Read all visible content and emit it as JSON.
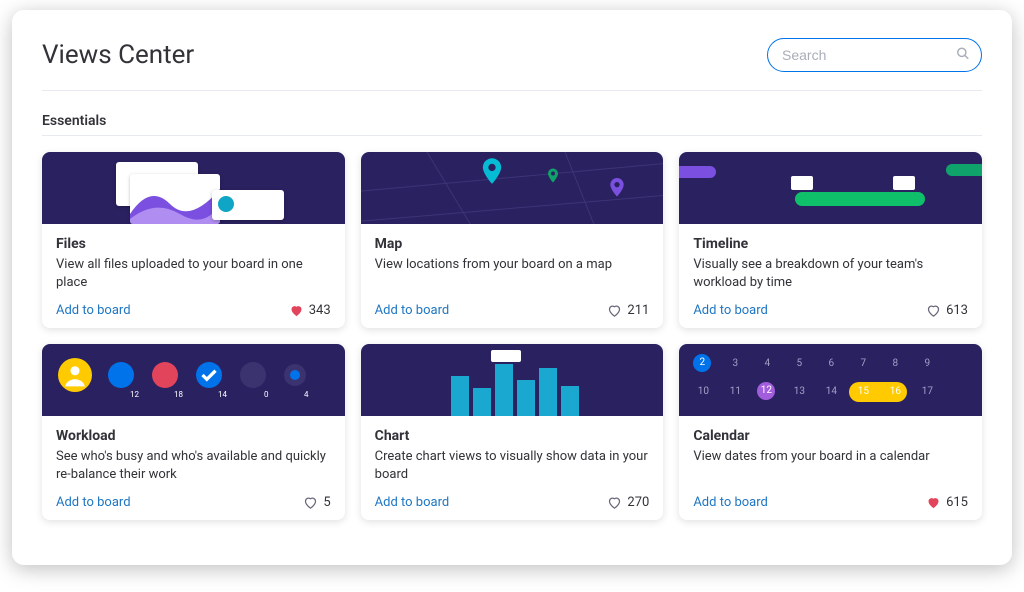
{
  "header": {
    "title": "Views Center"
  },
  "search": {
    "placeholder": "Search"
  },
  "section": {
    "title": "Essentials"
  },
  "cards": [
    {
      "title": "Files",
      "desc": "View all files uploaded to your board in one place",
      "action": "Add to board",
      "likes": "343",
      "liked": true
    },
    {
      "title": "Map",
      "desc": "View locations from your board on a map",
      "action": "Add to board",
      "likes": "211",
      "liked": false
    },
    {
      "title": "Timeline",
      "desc": "Visually see a breakdown of your team's workload by time",
      "action": "Add to board",
      "likes": "613",
      "liked": false
    },
    {
      "title": "Workload",
      "desc": "See who's busy and who's available and quickly re-balance their work",
      "action": "Add to board",
      "likes": "5",
      "liked": false
    },
    {
      "title": "Chart",
      "desc": "Create chart views to visually show data in your board",
      "action": "Add to board",
      "likes": "270",
      "liked": false
    },
    {
      "title": "Calendar",
      "desc": "View dates from your board in a calendar",
      "action": "Add to board",
      "likes": "615",
      "liked": true
    }
  ],
  "workload_counts": [
    "",
    "12",
    "18",
    "14",
    "0",
    "4"
  ],
  "calendar_row1": [
    "2",
    "3",
    "4",
    "5",
    "6",
    "7",
    "8",
    "9"
  ],
  "calendar_row2": [
    "10",
    "11",
    "12",
    "13",
    "14",
    "15",
    "16",
    "17"
  ],
  "colors": {
    "accent": "#1f76c2",
    "heart": "#e2445c",
    "thumb_bg": "#2a2160"
  }
}
